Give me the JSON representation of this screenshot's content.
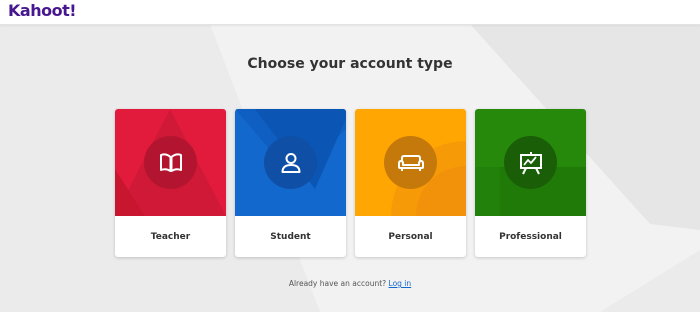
{
  "header": {
    "logo_text": "Kahoot!"
  },
  "main": {
    "title": "Choose your account type",
    "cards": [
      {
        "label": "Teacher",
        "color": "#e21b3c",
        "icon": "book-icon"
      },
      {
        "label": "Student",
        "color": "#1368ce",
        "icon": "user-icon"
      },
      {
        "label": "Personal",
        "color": "#ffa602",
        "icon": "sofa-icon"
      },
      {
        "label": "Professional",
        "color": "#26890c",
        "icon": "presentation-icon"
      }
    ]
  },
  "footer": {
    "prompt": "Already have an account?",
    "login_link": "Log in"
  },
  "colors": {
    "brand": "#46178f",
    "link": "#1368ce",
    "background": "#f2f2f2"
  }
}
